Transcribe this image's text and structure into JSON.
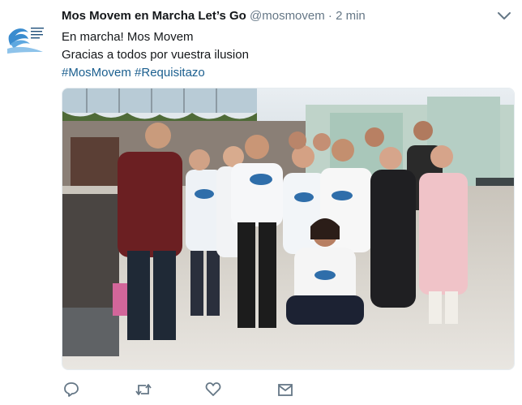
{
  "tweet": {
    "avatar_text": "Mos Movem En Marcha Let's Go",
    "display_name": "Mos Movem en Marcha Let’s Go",
    "handle": "@mosmovem",
    "separator": "·",
    "time": "2 min",
    "lines": [
      "En marcha! Mos Movem",
      "Gracias a todos por vuestra ilusion"
    ],
    "hashtags": [
      "#MosMovem",
      "#Requisitazo"
    ],
    "photo_icon": "group-photo",
    "actions": [
      "reply-icon",
      "retweet-icon",
      "like-icon",
      "message-icon"
    ]
  },
  "colors": {
    "text": "#14171a",
    "muted": "#657786",
    "link": "#1b5f8f",
    "icon": "#657786",
    "logo_blue": "#3a8ccf"
  }
}
